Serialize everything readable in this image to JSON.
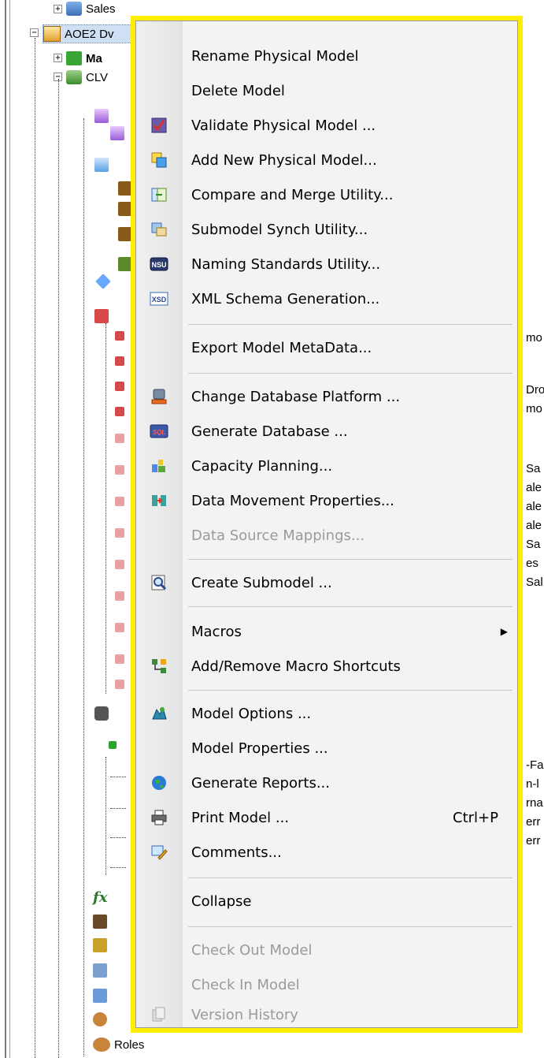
{
  "tree": {
    "top_partial": "Sales",
    "selected_node": "AOE2 Dv",
    "node_ma": "Ma",
    "node_clv": "CLV",
    "bottom_node": "Roles"
  },
  "right_partial": {
    "r1": "mo",
    "r2": "Dro",
    "r3": "mo",
    "r4": "Sa",
    "r5": "ale",
    "r6": "ale",
    "r7": "ale",
    "r8": "Sa",
    "r9": "es",
    "r10": "Sal",
    "r11": "-Fa",
    "r12": "n-l",
    "r13": "rna",
    "r14": "err",
    "r15": "err"
  },
  "menu": {
    "rename": "Rename Physical Model",
    "delete": "Delete Model",
    "validate": "Validate Physical Model ...",
    "add_new": "Add New Physical Model...",
    "compare_merge": "Compare and Merge Utility...",
    "submodel_synch": "Submodel Synch Utility...",
    "naming_standards": "Naming Standards Utility...",
    "xml_schema": "XML Schema Generation...",
    "export_metadata": "Export Model MetaData...",
    "change_platform": "Change Database Platform ...",
    "generate_db": "Generate Database ...",
    "capacity": "Capacity Planning...",
    "data_movement": "Data Movement Properties...",
    "data_source_mappings": "Data Source Mappings...",
    "create_submodel": "Create Submodel ...",
    "macros": "Macros",
    "macro_shortcuts": "Add/Remove Macro Shortcuts",
    "model_options": "Model Options ...",
    "model_properties": "Model Properties ...",
    "generate_reports": "Generate Reports...",
    "print_model": "Print Model ...",
    "print_shortcut": "Ctrl+P",
    "comments": "Comments...",
    "collapse": "Collapse",
    "check_out": "Check Out Model",
    "check_in": "Check In Model",
    "version_history": "Version History"
  },
  "icon_labels": {
    "nsu": "NSU",
    "xsd": "XSD",
    "sql": "SQL"
  },
  "colors": {
    "highlight_border": "#ffee00",
    "menu_bg": "#f3f3f3",
    "disabled_text": "#9a9a9a"
  }
}
